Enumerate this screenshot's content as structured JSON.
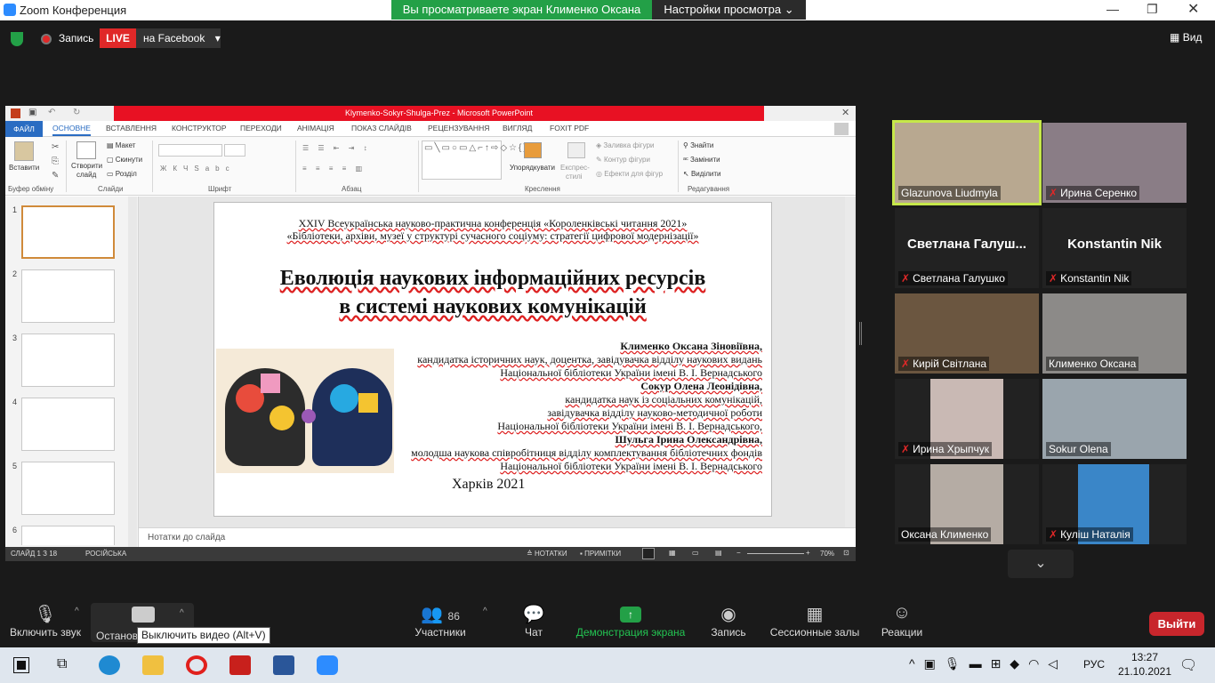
{
  "window": {
    "title": "Zoom Конференция"
  },
  "banner": {
    "viewing": "Вы просматриваете экран Клименко Оксана",
    "view_settings": "Настройки просмотра"
  },
  "topbar": {
    "record": "Запись",
    "live": "LIVE",
    "live_target": "на Facebook",
    "view": "Вид"
  },
  "ppt": {
    "title": "Klymenko-Sokyr-Shulga-Prez - Microsoft PowerPoint",
    "tabs": [
      "ФАЙЛ",
      "ОСНОВНЕ",
      "ВСТАВЛЕННЯ",
      "КОНСТРУКТОР",
      "ПЕРЕХОДИ",
      "АНІМАЦІЯ",
      "ПОКАЗ СЛАЙДІВ",
      "РЕЦЕНЗУВАННЯ",
      "ВИГЛЯД",
      "FOXIT PDF"
    ],
    "ribbon": {
      "paste": "Вставити",
      "new_slide_1": "Створити",
      "new_slide_2": "слайд",
      "layout": "Макет",
      "reset": "Скинути",
      "section": "Розділ",
      "find": "Знайти",
      "replace": "Замінити",
      "select": "Виділити",
      "arrange": "Упорядкувати",
      "quick_1": "Експрес-",
      "quick_2": "стилі",
      "fill": "Заливка фігури",
      "outline": "Контур фігури",
      "effects": "Ефекти для фігур"
    },
    "groups": [
      "Буфер обміну",
      "Слайди",
      "Шрифт",
      "Абзац",
      "Креслення",
      "Редагування"
    ],
    "thumb_numbers": [
      "1",
      "2",
      "3",
      "4",
      "5",
      "6"
    ],
    "notes": "Нотатки до слайда",
    "status": {
      "slide": "СЛАЙД 1 З 18",
      "lang": "РОСІЙСЬКА",
      "notes": "НОТАТКИ",
      "comments": "ПРИМІТКИ",
      "zoom": "70%"
    }
  },
  "slide": {
    "conf1": "XXIV Всеукраїнська науково-практична конференція  «Короленківські читання 2021»",
    "conf2": "«Бібліотеки, архіви, музеї у структурі сучасного соціуму: стратегії цифрової модернізації»",
    "title1": "Еволюція наукових інформаційних ресурсів",
    "title2": "в системі наукових комунікацій",
    "a1": "Клименко Оксана Зіновіївна,",
    "a1l1": "кандидатка історичних наук, доцентка, завідувачка відділу наукових видань",
    "a1l2": "Національної бібліотеки України імені В. І. Вернадського",
    "a2": "Сокур Олена Леонідівна,",
    "a2l1": "кандидатка наук із соціальних комунікацій,",
    "a2l2": "завідувачка відділу науково-методичної роботи",
    "a2l3": "Національної бібліотеки України імені В. І. Вернадського,",
    "a3": "Шульга Ірина Олександрівна,",
    "a3l1": "молодша наукова співробітниця відділу комплектування бібліотечних фондів",
    "a3l2": "Національної бібліотеки України імені В. І. Вернадського",
    "city": "Харків 2021"
  },
  "participants": [
    {
      "name": "Glazunova Liudmyla",
      "muted": false,
      "video": true,
      "color": "#b8a890"
    },
    {
      "name": "Ирина Серенко",
      "muted": true,
      "video": true,
      "color": "#8a7d86"
    },
    {
      "name": "Светлана Галушко",
      "muted": true,
      "video": false,
      "big": "Светлана  Галуш..."
    },
    {
      "name": "Konstantin Nik",
      "muted": true,
      "video": false,
      "big": "Konstantin Nik"
    },
    {
      "name": "Кирій Світлана",
      "muted": true,
      "video": true,
      "color": "#6b5640"
    },
    {
      "name": "Клименко Оксана",
      "muted": false,
      "video": true,
      "color": "#8c8a88"
    },
    {
      "name": "Ирина Хрыпчук",
      "muted": true,
      "video": true,
      "color": "#c9b9b4"
    },
    {
      "name": "Sokur Olena",
      "muted": false,
      "video": true,
      "color": "#9aa5ad"
    },
    {
      "name": "Оксана Клименко",
      "muted": false,
      "video": true,
      "color": "#b5aca4"
    },
    {
      "name": "Куліш Наталія",
      "muted": true,
      "video": true,
      "color": "#3a86c8"
    }
  ],
  "toolbar": {
    "unmute": "Включить звук",
    "stop_video": "Останов",
    "participants": "Участники",
    "participants_count": "86",
    "chat": "Чат",
    "share": "Демонстрация экрана",
    "record": "Запись",
    "rooms": "Сессионные залы",
    "reactions": "Реакции",
    "leave": "Выйти",
    "tooltip": "Выключить видео (Alt+V)"
  },
  "taskbar": {
    "lang": "РУС",
    "time": "13:27",
    "date": "21.10.2021"
  }
}
